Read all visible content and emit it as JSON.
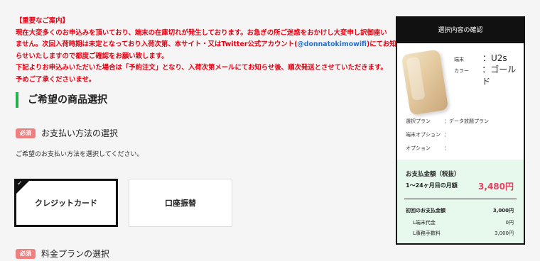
{
  "notice": {
    "title": "【重要なご案内】",
    "line1": "現在大変多くのお申込みを頂いており、端末の在庫切れが発生しております。お急ぎの所ご迷惑をおかけし大変申し訳御座い",
    "line2_pre": "ません。次回入荷時期は未定となっており入荷次第、本サイト・又はTwitter公式アカウント(",
    "line2_link": "@donnatokimowifi",
    "line2_post": ")にてお知",
    "line3": "らせいたしますので都度ご確認をお願い致します。",
    "line4": "下記よりお申込みいただいた場合は「予約注文」となり、入荷次第メールにてお知らせ後、順次発送とさせていただきます。",
    "line5": "予めご了承くださいませ。"
  },
  "section_title": "ご希望の商品選択",
  "required_badge": "必須",
  "payment": {
    "title": "お支払い方法の選択",
    "description": "ご希望のお支払い方法を選択してください。",
    "options": [
      "クレジットカード",
      "口座振替"
    ],
    "selected": "クレジットカード"
  },
  "plan_section_title": "料金プランの選択",
  "summary": {
    "header": "選択内容の確認",
    "device_label": "端末",
    "device_value": "U2s",
    "color_label": "カラー",
    "color_value": "ゴールド",
    "plan_label": "選択プラン",
    "plan_value": "：データ放題プラン",
    "option_device_label": "端末オプション",
    "option_device_value": "：",
    "option_label": "オプション",
    "option_value": "：",
    "total_label": "お支払金額（税抜）",
    "monthly_label": "1〜24ヶ月目の月額",
    "monthly_value": "3,480円",
    "initial_label": "初回のお支払金額",
    "initial_value": "3,000円",
    "device_fee_label": "L端末代金",
    "device_fee_value": "0円",
    "admin_fee_label": "L事務手数料",
    "admin_fee_value": "3,000円"
  }
}
